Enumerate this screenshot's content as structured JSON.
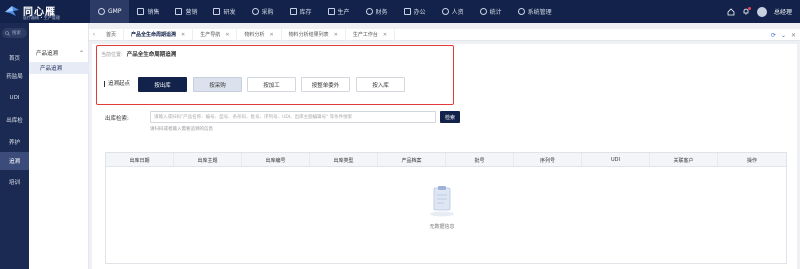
{
  "app": {
    "logo_text": "同心雁",
    "logo_sub": "医疗器械 • 生产管理"
  },
  "nav": [
    {
      "label": "GMP",
      "icon": "shield-icon",
      "active": true
    },
    {
      "label": "销售",
      "icon": "chart-icon"
    },
    {
      "label": "营销",
      "icon": "bar-chart-icon"
    },
    {
      "label": "研发",
      "icon": "lab-icon"
    },
    {
      "label": "采购",
      "icon": "cart-icon"
    },
    {
      "label": "库存",
      "icon": "box-icon"
    },
    {
      "label": "生产",
      "icon": "factory-icon"
    },
    {
      "label": "财务",
      "icon": "money-icon"
    },
    {
      "label": "办公",
      "icon": "briefcase-icon"
    },
    {
      "label": "人资",
      "icon": "user-icon"
    },
    {
      "label": "统计",
      "icon": "clock-icon"
    },
    {
      "label": "系统管理",
      "icon": "gear-icon"
    }
  ],
  "user": {
    "name": "总经理"
  },
  "sidebar": {
    "search_placeholder": "搜索",
    "items": [
      {
        "label": "首页"
      },
      {
        "label": "药监局"
      },
      {
        "label": "UDI"
      },
      {
        "label": "出库检"
      },
      {
        "label": "养护"
      },
      {
        "label": "追溯",
        "active": true
      },
      {
        "label": "培训"
      }
    ]
  },
  "submenu": {
    "group": "产品追溯",
    "item": "产品追溯"
  },
  "tabs": [
    {
      "label": "首页"
    },
    {
      "label": "产品全生命周期追溯",
      "active": true
    },
    {
      "label": "生产导航"
    },
    {
      "label": "物料分析"
    },
    {
      "label": "物料分析结果列表"
    },
    {
      "label": "生产工作台"
    }
  ],
  "content": {
    "breadcrumb_prefix": "当前位置:",
    "breadcrumb_title": "产品全生命周期追溯",
    "trace_label": "追溯起点",
    "trace_buttons": [
      {
        "label": "按出库",
        "state": "primary"
      },
      {
        "label": "按采购",
        "state": "selected"
      },
      {
        "label": "按加工",
        "state": "normal"
      },
      {
        "label": "按整单委外",
        "state": "normal"
      },
      {
        "label": "按入库",
        "state": "normal"
      }
    ],
    "query_label": "出库检索:",
    "query_placeholder": "请输入或扫码\"产品名称、编号、型号、条形码、批号、序列号、UDI、出库主题编辑号\" 等条件搜索",
    "query_button": "检索",
    "query_hint": "请扫码或者输入需要追溯的信息",
    "table_headers": [
      "出库日期",
      "出库主题",
      "出库编号",
      "出库类型",
      "产品档案",
      "批号",
      "序列号",
      "UDI",
      "关联客户",
      "操作"
    ],
    "empty_text": "无数据信息"
  },
  "colors": {
    "topbar": "#12224a",
    "sidebar": "#1b2a52",
    "primary": "#12224a",
    "highlight": "#e23b3b"
  }
}
